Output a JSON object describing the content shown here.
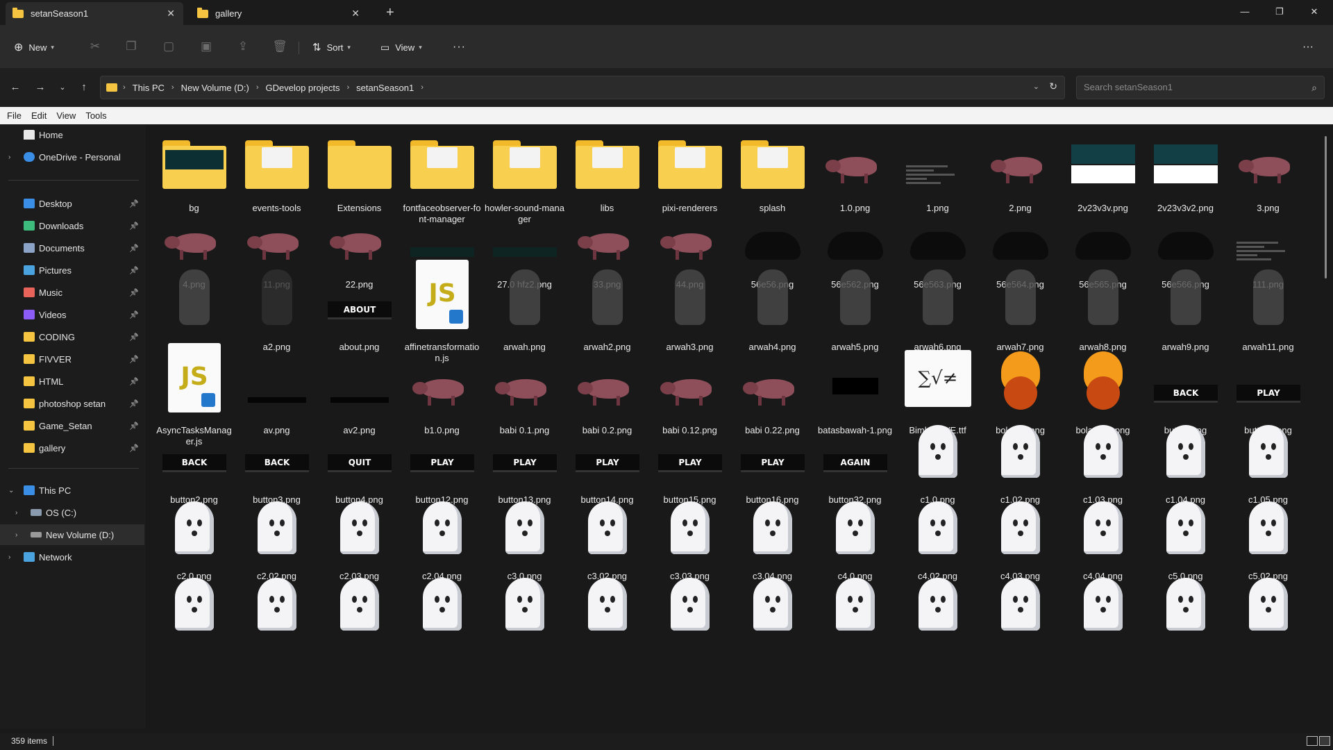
{
  "tabs": [
    {
      "label": "setanSeason1",
      "active": true
    },
    {
      "label": "gallery",
      "active": false
    }
  ],
  "toolbar": {
    "new_label": "New",
    "sort_label": "Sort",
    "view_label": "View",
    "more_label": "···"
  },
  "breadcrumb": [
    "This PC",
    "New Volume (D:)",
    "GDevelop projects",
    "setanSeason1"
  ],
  "search": {
    "placeholder": "Search setanSeason1"
  },
  "menu": [
    "File",
    "Edit",
    "View",
    "Tools"
  ],
  "sidebar": {
    "home": "Home",
    "onedrive": "OneDrive - Personal",
    "quick_access": [
      {
        "label": "Desktop",
        "icon": "desktop-icon",
        "color": "#3a8ee6"
      },
      {
        "label": "Downloads",
        "icon": "download-icon",
        "color": "#3dbb7c"
      },
      {
        "label": "Documents",
        "icon": "documents-icon",
        "color": "#8aa3c7"
      },
      {
        "label": "Pictures",
        "icon": "pictures-icon",
        "color": "#4aa3df"
      },
      {
        "label": "Music",
        "icon": "music-icon",
        "color": "#e8635a"
      },
      {
        "label": "Videos",
        "icon": "videos-icon",
        "color": "#8b5cf6"
      },
      {
        "label": "CODING",
        "icon": "folder-icon",
        "color": "#f5c542"
      },
      {
        "label": "FIVVER",
        "icon": "folder-icon",
        "color": "#f5c542"
      },
      {
        "label": "HTML",
        "icon": "folder-icon",
        "color": "#f5c542"
      },
      {
        "label": "photoshop setan",
        "icon": "folder-icon",
        "color": "#f5c542"
      },
      {
        "label": "Game_Setan",
        "icon": "folder-icon",
        "color": "#f5c542"
      },
      {
        "label": "gallery",
        "icon": "folder-icon",
        "color": "#f5c542"
      }
    ],
    "this_pc": "This PC",
    "drives": [
      "OS (C:)",
      "New Volume (D:)"
    ],
    "network": "Network"
  },
  "files": [
    {
      "name": "bg",
      "kind": "folder-dark"
    },
    {
      "name": "events-tools",
      "kind": "folder-paper"
    },
    {
      "name": "Extensions",
      "kind": "folder"
    },
    {
      "name": "fontfaceobserver-font-manager",
      "kind": "folder-paper"
    },
    {
      "name": "howler-sound-manager",
      "kind": "folder-paper"
    },
    {
      "name": "libs",
      "kind": "folder-paper"
    },
    {
      "name": "pixi-renderers",
      "kind": "folder-paper"
    },
    {
      "name": "splash",
      "kind": "folder-paper"
    },
    {
      "name": "1.0.png",
      "kind": "boar"
    },
    {
      "name": "1.png",
      "kind": "graybars"
    },
    {
      "name": "2.png",
      "kind": "boar"
    },
    {
      "name": "2v23v3v.png",
      "kind": "tealwhite"
    },
    {
      "name": "2v23v3v2.png",
      "kind": "tealwhite"
    },
    {
      "name": "3.png",
      "kind": "boar"
    },
    {
      "name": "4.png",
      "kind": "boar"
    },
    {
      "name": "11.png",
      "kind": "boar"
    },
    {
      "name": "22.png",
      "kind": "boar"
    },
    {
      "name": "27.0 hfz.png",
      "kind": "darkbar"
    },
    {
      "name": "27.0 hfz2.png",
      "kind": "darkbar"
    },
    {
      "name": "33.png",
      "kind": "boar"
    },
    {
      "name": "44.png",
      "kind": "boar"
    },
    {
      "name": "56e56.png",
      "kind": "blob"
    },
    {
      "name": "56e562.png",
      "kind": "blob"
    },
    {
      "name": "56e563.png",
      "kind": "blob"
    },
    {
      "name": "56e564.png",
      "kind": "blob"
    },
    {
      "name": "56e565.png",
      "kind": "blob"
    },
    {
      "name": "56e566.png",
      "kind": "blob"
    },
    {
      "name": "111.png",
      "kind": "graybars"
    },
    {
      "name": "a1.png",
      "kind": "shadow"
    },
    {
      "name": "a2.png",
      "kind": "shadow-faint"
    },
    {
      "name": "about.png",
      "kind": "button",
      "text": "ABOUT"
    },
    {
      "name": "affinetransformation.js",
      "kind": "js"
    },
    {
      "name": "arwah.png",
      "kind": "shadow"
    },
    {
      "name": "arwah2.png",
      "kind": "shadow"
    },
    {
      "name": "arwah3.png",
      "kind": "shadow"
    },
    {
      "name": "arwah4.png",
      "kind": "shadow"
    },
    {
      "name": "arwah5.png",
      "kind": "shadow"
    },
    {
      "name": "arwah6.png",
      "kind": "shadow"
    },
    {
      "name": "arwah7.png",
      "kind": "shadow"
    },
    {
      "name": "arwah8.png",
      "kind": "shadow"
    },
    {
      "name": "arwah9.png",
      "kind": "shadow"
    },
    {
      "name": "arwah11.png",
      "kind": "shadow"
    },
    {
      "name": "AsyncTasksManager.js",
      "kind": "js"
    },
    {
      "name": "av.png",
      "kind": "blackbar"
    },
    {
      "name": "av2.png",
      "kind": "blackbar"
    },
    {
      "name": "b1.0.png",
      "kind": "boar"
    },
    {
      "name": "babi 0.1.png",
      "kind": "boar"
    },
    {
      "name": "babi 0.2.png",
      "kind": "boar"
    },
    {
      "name": "babi 0.12.png",
      "kind": "boar"
    },
    {
      "name": "babi 0.22.png",
      "kind": "boar"
    },
    {
      "name": "batasbawah-1.png",
      "kind": "blackrect"
    },
    {
      "name": "Bimbo_JVE.ttf",
      "kind": "font",
      "text": "∑√≠"
    },
    {
      "name": "bola api.png",
      "kind": "fire"
    },
    {
      "name": "bola api2.png",
      "kind": "fire"
    },
    {
      "name": "button.png",
      "kind": "button",
      "text": "BACK"
    },
    {
      "name": "button1.png",
      "kind": "button",
      "text": "PLAY"
    },
    {
      "name": "button2.png",
      "kind": "button",
      "text": "BACK"
    },
    {
      "name": "button3.png",
      "kind": "button",
      "text": "BACK"
    },
    {
      "name": "button4.png",
      "kind": "button",
      "text": "QUIT"
    },
    {
      "name": "button12.png",
      "kind": "button",
      "text": "PLAY"
    },
    {
      "name": "button13.png",
      "kind": "button",
      "text": "PLAY"
    },
    {
      "name": "button14.png",
      "kind": "button",
      "text": "PLAY"
    },
    {
      "name": "button15.png",
      "kind": "button",
      "text": "PLAY"
    },
    {
      "name": "button16.png",
      "kind": "button",
      "text": "PLAY"
    },
    {
      "name": "button32.png",
      "kind": "button",
      "text": "AGAIN"
    },
    {
      "name": "c1.0.png",
      "kind": "ghost"
    },
    {
      "name": "c1.02.png",
      "kind": "ghost"
    },
    {
      "name": "c1.03.png",
      "kind": "ghost"
    },
    {
      "name": "c1.04.png",
      "kind": "ghost"
    },
    {
      "name": "c1.05.png",
      "kind": "ghost"
    },
    {
      "name": "c2.0.png",
      "kind": "ghost"
    },
    {
      "name": "c2.02.png",
      "kind": "ghost"
    },
    {
      "name": "c2.03.png",
      "kind": "ghost"
    },
    {
      "name": "c2.04.png",
      "kind": "ghost"
    },
    {
      "name": "c3.0.png",
      "kind": "ghost"
    },
    {
      "name": "c3.02.png",
      "kind": "ghost"
    },
    {
      "name": "c3.03.png",
      "kind": "ghost"
    },
    {
      "name": "c3.04.png",
      "kind": "ghost"
    },
    {
      "name": "c4.0.png",
      "kind": "ghost"
    },
    {
      "name": "c4.02.png",
      "kind": "ghost"
    },
    {
      "name": "c4.03.png",
      "kind": "ghost"
    },
    {
      "name": "c4.04.png",
      "kind": "ghost"
    },
    {
      "name": "c5.0.png",
      "kind": "ghost"
    },
    {
      "name": "c5.02.png",
      "kind": "ghost"
    },
    {
      "name": "",
      "kind": "ghost"
    },
    {
      "name": "",
      "kind": "ghost"
    },
    {
      "name": "",
      "kind": "ghost"
    },
    {
      "name": "",
      "kind": "ghost"
    },
    {
      "name": "",
      "kind": "ghost"
    },
    {
      "name": "",
      "kind": "ghost"
    },
    {
      "name": "",
      "kind": "ghost"
    },
    {
      "name": "",
      "kind": "ghost"
    },
    {
      "name": "",
      "kind": "ghost"
    },
    {
      "name": "",
      "kind": "ghost"
    },
    {
      "name": "",
      "kind": "ghost"
    },
    {
      "name": "",
      "kind": "ghost"
    },
    {
      "name": "",
      "kind": "ghost"
    },
    {
      "name": "",
      "kind": "ghost"
    }
  ],
  "status": {
    "item_count": "359 items"
  }
}
